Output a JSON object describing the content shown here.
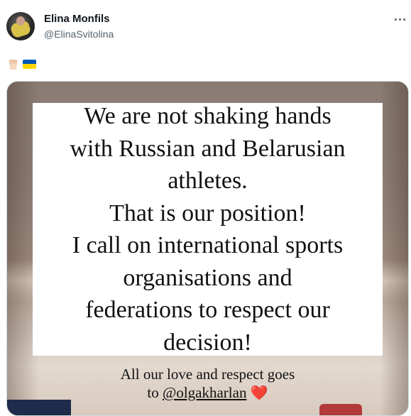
{
  "tweet": {
    "author_name": "Elina Monfils",
    "author_handle": "@ElinaSvitolina",
    "body_emojis": [
      "raised-fist-light-skin",
      "flag-ukraine"
    ],
    "more_icon": "more-horizontal-icon"
  },
  "media": {
    "card_lines": [
      "We are not shaking hands",
      "with Russian and Belarusian",
      "athletes.",
      "That is our position!",
      "I call on international sports",
      "organisations and",
      "federations to respect our",
      "decision!"
    ],
    "caption_line1": "All our love and respect goes",
    "caption_to": "to",
    "caption_mention": "@olgakharlan",
    "caption_heart": "❤️"
  },
  "colors": {
    "flag_blue": "#0057b7",
    "flag_yellow": "#ffd700",
    "handle_gray": "#536471"
  }
}
